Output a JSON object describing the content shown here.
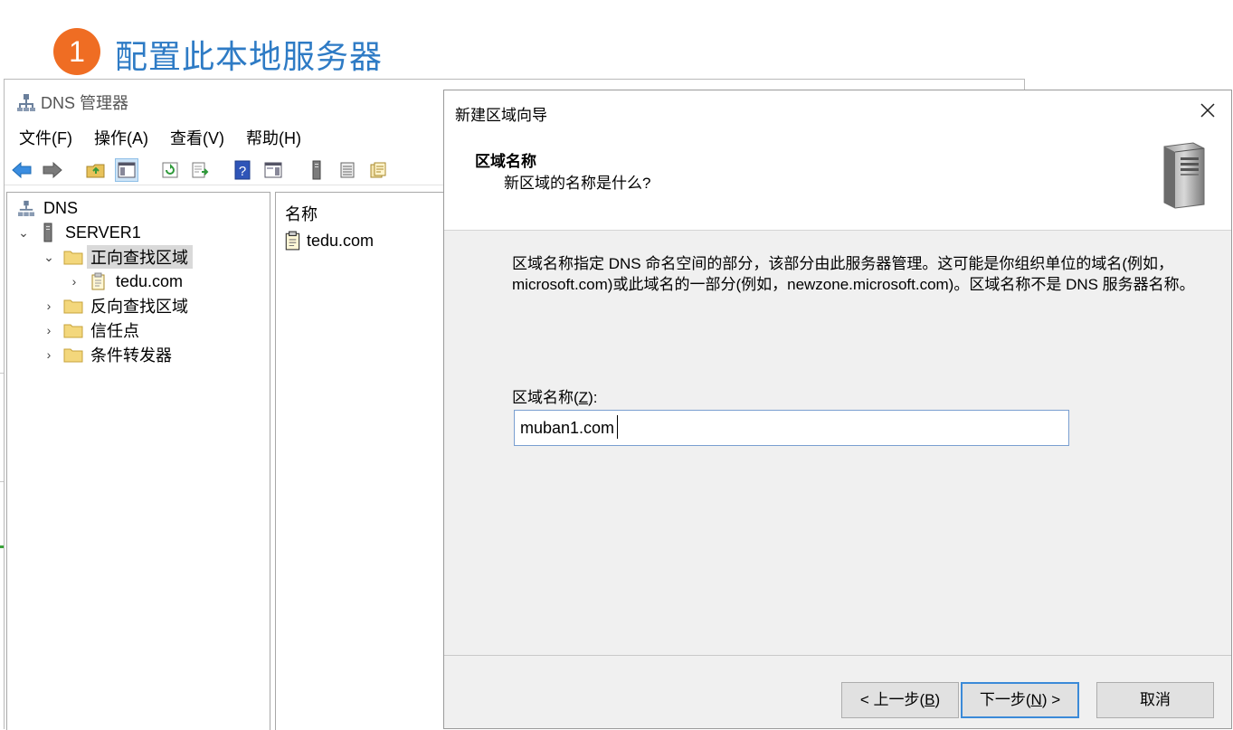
{
  "slide": {
    "step_number": "1",
    "title": "配置此本地服务器"
  },
  "dns_manager": {
    "window_title": "DNS 管理器",
    "menu": [
      "文件(F)",
      "操作(A)",
      "查看(V)",
      "帮助(H)"
    ],
    "toolbar_icons": [
      "back-arrow-icon",
      "forward-arrow-icon",
      "up-folder-icon",
      "show-hide-console-tree-icon",
      "refresh-icon",
      "export-list-icon",
      "help-icon",
      "show-action-pane-icon",
      "server-icon",
      "list-view-icon",
      "properties-icon"
    ],
    "tree": {
      "root": "DNS",
      "server": "SERVER1",
      "forward_zones": "正向查找区域",
      "zone": "tedu.com",
      "reverse_zones": "反向查找区域",
      "trust_points": "信任点",
      "conditional_forwarders": "条件转发器"
    },
    "list": {
      "column_name": "名称",
      "items": [
        "tedu.com"
      ]
    }
  },
  "wizard": {
    "title": "新建区域向导",
    "header_title": "区域名称",
    "header_subtitle": "新区域的名称是什么?",
    "description": "区域名称指定 DNS 命名空间的部分，该部分由此服务器管理。这可能是你组织单位的域名(例如，microsoft.com)或此域名的一部分(例如，newzone.microsoft.com)。区域名称不是 DNS 服务器名称。",
    "zone_name_label_prefix": "区域名称(",
    "zone_name_label_key": "Z",
    "zone_name_label_suffix": "):",
    "zone_name_value": "muban1.com",
    "buttons": {
      "back_prefix": "< 上一步(",
      "back_key": "B",
      "back_suffix": ")",
      "next_prefix": "下一步(",
      "next_key": "N",
      "next_suffix": ") >",
      "cancel": "取消"
    }
  }
}
